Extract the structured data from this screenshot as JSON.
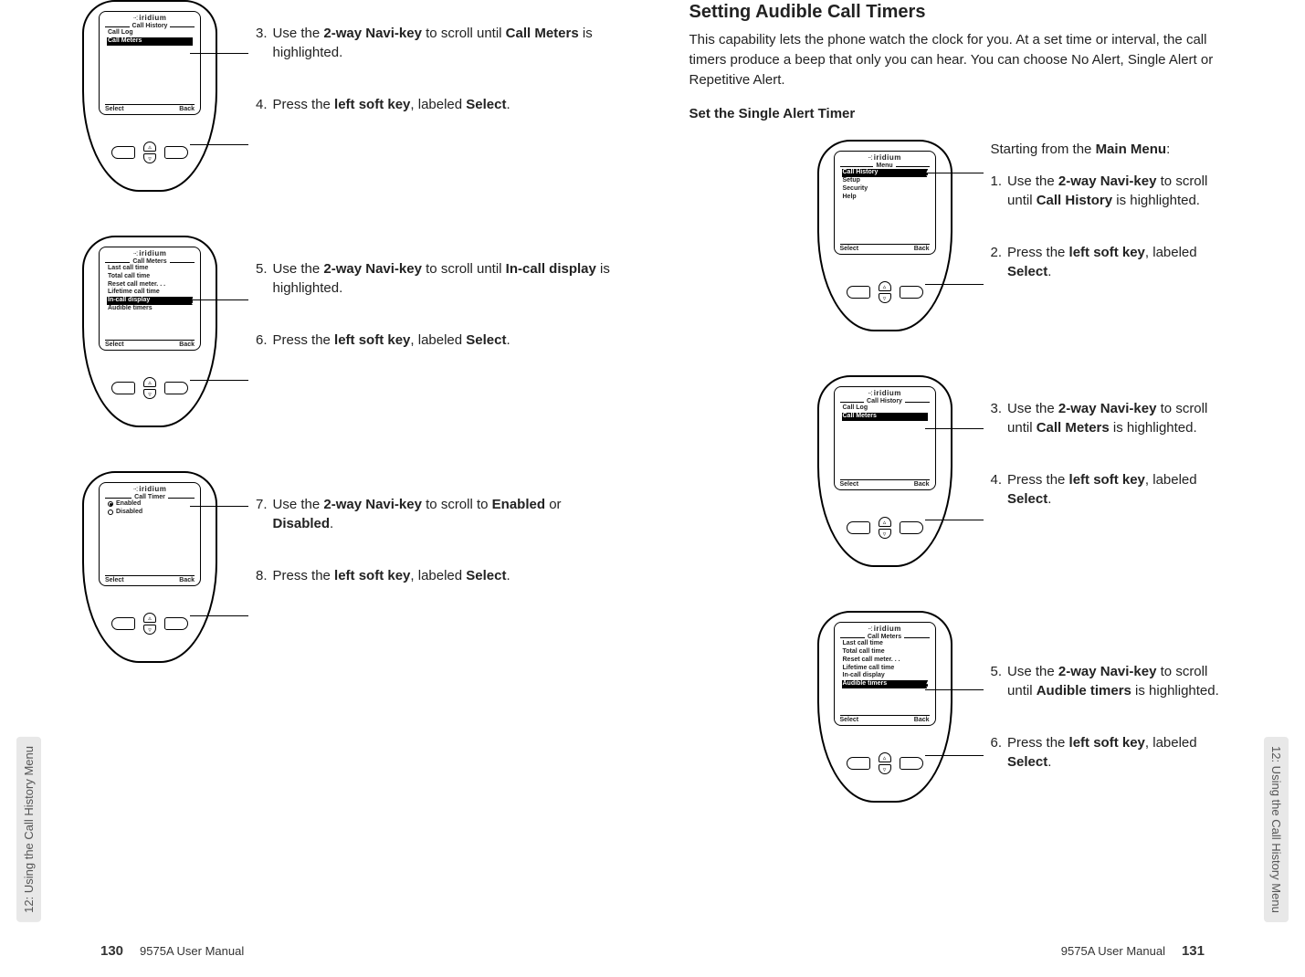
{
  "chapter_tab": "12: Using the Call History Menu",
  "manual_name": "9575A User Manual",
  "left_page_number": "130",
  "right_page_number": "131",
  "brand": "iridium",
  "softkeys": {
    "left": "Select",
    "right": "Back"
  },
  "left": {
    "phone1": {
      "menu_title": "Call History",
      "items": [
        "Call Log",
        "Call Meters"
      ],
      "highlight": "Call Meters"
    },
    "steps1": [
      {
        "n": "3.",
        "text_a": "Use the ",
        "b1": "2-way Navi-key",
        "text_b": " to scroll until ",
        "b2": "Call Meters",
        "text_c": " is highlighted."
      },
      {
        "n": "4.",
        "text_a": "Press the ",
        "b1": "left soft key",
        "text_b": ", labeled ",
        "b2": "Select",
        "text_c": "."
      }
    ],
    "phone2": {
      "menu_title": "Call Meters",
      "items": [
        "Last call time",
        "Total call time",
        "Reset call meter. . .",
        "Lifetime call time",
        "In-call display",
        "Audible timers"
      ],
      "highlight": "In-call display"
    },
    "steps2": [
      {
        "n": "5.",
        "text_a": "Use the ",
        "b1": "2-way Navi-key",
        "text_b": " to scroll until ",
        "b2": "In-call display",
        "text_c": " is highlighted."
      },
      {
        "n": "6.",
        "text_a": "Press the ",
        "b1": "left soft key",
        "text_b": ", labeled ",
        "b2": "Select",
        "text_c": "."
      }
    ],
    "phone3": {
      "menu_title": "Call Timer",
      "option_enabled": "Enabled",
      "option_disabled": "Disabled"
    },
    "steps3": [
      {
        "n": "7.",
        "text_a": "Use the ",
        "b1": "2-way Navi-key",
        "text_b": " to scroll to ",
        "b2": "Enabled",
        "text_c": " or ",
        "b3": "Disabled",
        "text_d": "."
      },
      {
        "n": "8.",
        "text_a": "Press the ",
        "b1": "left soft key",
        "text_b": ", labeled ",
        "b2": "Select",
        "text_c": "."
      }
    ]
  },
  "right": {
    "heading": "Setting Audible Call Timers",
    "lead": "This capability lets the phone watch the clock for you. At a set time or interval, the call timers produce a beep that only you can hear. You can choose No Alert, Single Alert or Repetitive Alert.",
    "sub": "Set the Single Alert Timer",
    "intro_line": "Starting from the ",
    "intro_bold": "Main Menu",
    "intro_after": ":",
    "phone1": {
      "menu_title": "Menu",
      "items": [
        "Call History",
        "Setup",
        "Security",
        "Help"
      ],
      "highlight": "Call History"
    },
    "steps1": [
      {
        "n": "1.",
        "text_a": "Use the ",
        "b1": "2-way Navi-key",
        "text_b": " to scroll until ",
        "b2": "Call History",
        "text_c": " is highlighted."
      },
      {
        "n": "2.",
        "text_a": "Press the ",
        "b1": "left soft key",
        "text_b": ", labeled ",
        "b2": "Select",
        "text_c": "."
      }
    ],
    "phone2": {
      "menu_title": "Call History",
      "items": [
        "Call Log",
        "Call Meters"
      ],
      "highlight": "Call Meters"
    },
    "steps2": [
      {
        "n": "3.",
        "text_a": "Use the ",
        "b1": "2-way Navi-key",
        "text_b": " to scroll until ",
        "b2": "Call Meters",
        "text_c": " is highlighted."
      },
      {
        "n": "4.",
        "text_a": "Press the ",
        "b1": "left soft key",
        "text_b": ", labeled ",
        "b2": "Select",
        "text_c": "."
      }
    ],
    "phone3": {
      "menu_title": "Call Meters",
      "items": [
        "Last call time",
        "Total call time",
        "Reset call meter. . .",
        "Lifetime call time",
        "In-call display",
        "Audible timers"
      ],
      "highlight": "Audible timers"
    },
    "steps3": [
      {
        "n": "5.",
        "text_a": "Use the ",
        "b1": "2-way Navi-key",
        "text_b": " to scroll until ",
        "b2": "Audible timers",
        "text_c": " is highlighted."
      },
      {
        "n": "6.",
        "text_a": "Press the ",
        "b1": "left soft key",
        "text_b": ", labeled ",
        "b2": "Select",
        "text_c": "."
      }
    ]
  }
}
